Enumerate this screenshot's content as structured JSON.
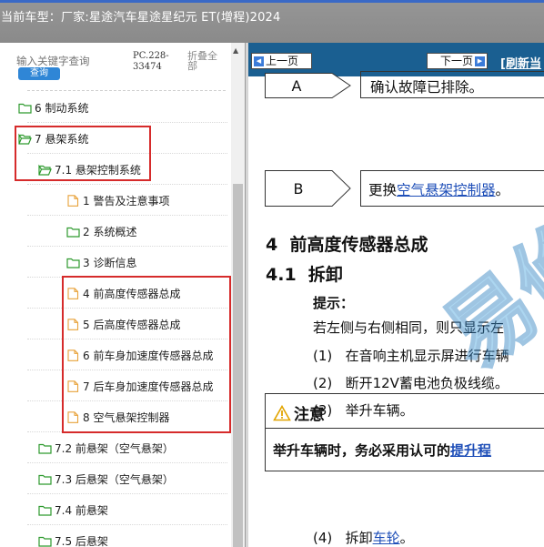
{
  "header": {
    "model_label": "当前车型：厂家:星途汽车星途星纪元 ET(增程)2024"
  },
  "sidebar": {
    "search_placeholder": "输入关键字查询",
    "search_button": "查询",
    "pc_code": "PC.228-33474",
    "fold_all": "折叠全部",
    "items": [
      {
        "label": "6 制动系统"
      },
      {
        "label": "7 悬架系统"
      },
      {
        "label": "7.1 悬架控制系统"
      },
      {
        "label": "1 警告及注意事项"
      },
      {
        "label": "2 系统概述"
      },
      {
        "label": "3 诊断信息"
      },
      {
        "label": "4 前高度传感器总成"
      },
      {
        "label": "5 后高度传感器总成"
      },
      {
        "label": "6 前车身加速度传感器总成"
      },
      {
        "label": "7 后车身加速度传感器总成"
      },
      {
        "label": "8 空气悬架控制器"
      },
      {
        "label": "7.2 前悬架（空气悬架）"
      },
      {
        "label": "7.3 后悬架（空气悬架）"
      },
      {
        "label": "7.4 前悬架"
      },
      {
        "label": "7.5 后悬架"
      }
    ]
  },
  "toolbar": {
    "prev_label": "上一页",
    "next_label": "下一页",
    "refresh_label": "[刷新当"
  },
  "document": {
    "step_a": {
      "letter": "A",
      "text": "确认故障已排除。"
    },
    "step_b": {
      "letter": "B",
      "text_prefix": "更换",
      "link": "空气悬架控制器",
      "text_suffix": "。"
    },
    "section_title": "4  前高度传感器总成",
    "subsection_title": "4.1  拆卸",
    "hint_label": "提示：",
    "hint_text": "若左侧与右侧相同，则只显示左",
    "steps": [
      {
        "num": "(1)",
        "text": "在音响主机显示屏进行车辆"
      },
      {
        "num": "(2)",
        "text": "断开12V蓄电池负极线缆。"
      },
      {
        "num": "(3)",
        "text": "举升车辆。"
      }
    ],
    "note_title": "注意",
    "note_prefix": "举升车辆时，务必采用认可的",
    "note_link": "提升程",
    "step4": {
      "num": "(4)",
      "text": "拆卸",
      "link": "车轮",
      "suffix": "。"
    },
    "watermark_text": "易修"
  },
  "colors": {
    "highlight": "#d62b2b",
    "nav_bar": "#1a5f91",
    "link": "#1f4fb8",
    "folder_green": "#2e9a2e",
    "doc_orange": "#e8a23a"
  }
}
